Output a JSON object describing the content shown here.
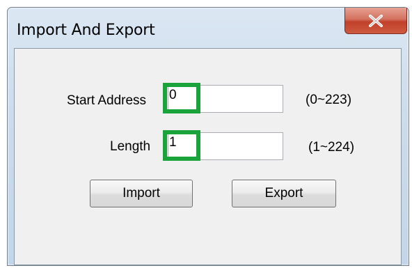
{
  "window": {
    "title": "Import And Export",
    "close_icon": "close-x-icon"
  },
  "form": {
    "start_address": {
      "label": "Start Address",
      "value": "0",
      "range": "(0~223)"
    },
    "length": {
      "label": "Length",
      "value": "1",
      "range": "(1~224)"
    }
  },
  "buttons": {
    "import_label": "Import",
    "export_label": "Export"
  },
  "colors": {
    "highlight": "#1aa33a",
    "close_button": "#c1402a",
    "dialog_background": "#f0f0f0"
  }
}
